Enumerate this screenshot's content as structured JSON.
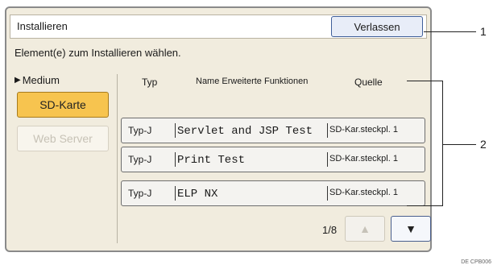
{
  "dialog": {
    "title": "Installieren",
    "exit_label": "Verlassen",
    "instruction": "Element(e) zum Installieren wählen."
  },
  "sidebar": {
    "medium_label": "Medium",
    "media_buttons": [
      {
        "label": "SD-Karte",
        "state": "selected"
      },
      {
        "label": "Web Server",
        "state": "disabled"
      }
    ]
  },
  "table": {
    "headers": {
      "type": "Typ",
      "name": "Name Erweiterte Funktionen",
      "source": "Quelle"
    },
    "rows": [
      {
        "type": "Typ-J",
        "name": "Servlet and JSP Test",
        "source": "SD-Kar.steckpl. 1"
      },
      {
        "type": "Typ-J",
        "name": "Print Test",
        "source": "SD-Kar.steckpl. 1"
      },
      {
        "type": "Typ-J",
        "name": "ELP NX",
        "source": "SD-Kar.steckpl. 1"
      }
    ]
  },
  "pagination": {
    "text": "1/8",
    "up_icon": "triangle-up-icon",
    "down_icon": "triangle-down-icon"
  },
  "callouts": [
    "1",
    "2"
  ],
  "figure_id": "DE CPB006"
}
